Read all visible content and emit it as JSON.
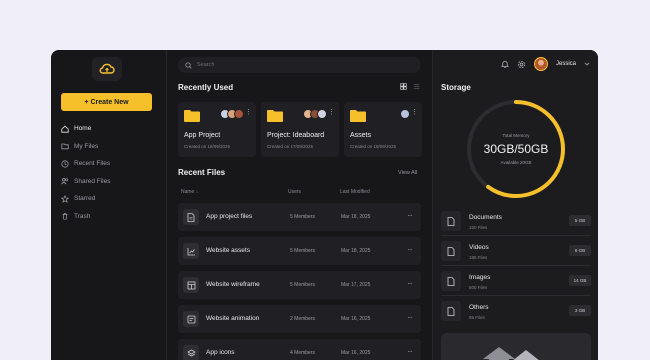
{
  "sidebar": {
    "create_label": "+ Create New",
    "items": [
      {
        "label": "Home",
        "icon": "home-icon",
        "active": true
      },
      {
        "label": "My Files",
        "icon": "folder-icon",
        "active": false
      },
      {
        "label": "Recent Files",
        "icon": "clock-icon",
        "active": false
      },
      {
        "label": "Shared Files",
        "icon": "users-icon",
        "active": false
      },
      {
        "label": "Starred",
        "icon": "star-icon",
        "active": false
      },
      {
        "label": "Trash",
        "icon": "trash-icon",
        "active": false
      }
    ]
  },
  "search": {
    "placeholder": "Search"
  },
  "recent_used": {
    "title": "Recently Used",
    "cards": [
      {
        "name": "App Project",
        "meta": "Created on 18/09/2025"
      },
      {
        "name": "Project: Ideaboard",
        "meta": "Created on 17/09/2025"
      },
      {
        "name": "Assets",
        "meta": "Created on 19/09/2025"
      }
    ]
  },
  "recent_files": {
    "title": "Recent Files",
    "view_all": "View All",
    "columns": [
      "Name ↓",
      "Users",
      "Last Modified"
    ],
    "rows": [
      {
        "name": "App project files",
        "users": "5 Members",
        "modified": "Mar 18, 2025"
      },
      {
        "name": "Website assets",
        "users": "5 Members",
        "modified": "Mar 18, 2025"
      },
      {
        "name": "Website wireframe",
        "users": "5 Members",
        "modified": "Mar 17, 2025"
      },
      {
        "name": "Website animation",
        "users": "2 Members",
        "modified": "Mar 16, 2025"
      },
      {
        "name": "App icons",
        "users": "4 Members",
        "modified": "Mar 16, 2025"
      }
    ]
  },
  "header": {
    "username": "Jessica"
  },
  "storage": {
    "title": "Storage",
    "label": "Total Memory",
    "value": "30GB/50GB",
    "available": "Available 20GB",
    "used_fraction": 0.6,
    "items": [
      {
        "name": "Documents",
        "count": "150 Files",
        "size": "5 GB"
      },
      {
        "name": "Videos",
        "count": "185 Files",
        "size": "8 GB"
      },
      {
        "name": "Images",
        "count": "500 Files",
        "size": "14 GB"
      },
      {
        "name": "Others",
        "count": "85 Files",
        "size": "3 GB"
      }
    ]
  },
  "colors": {
    "accent": "#f6c02b",
    "panel": "#17171a",
    "card": "#202024"
  }
}
